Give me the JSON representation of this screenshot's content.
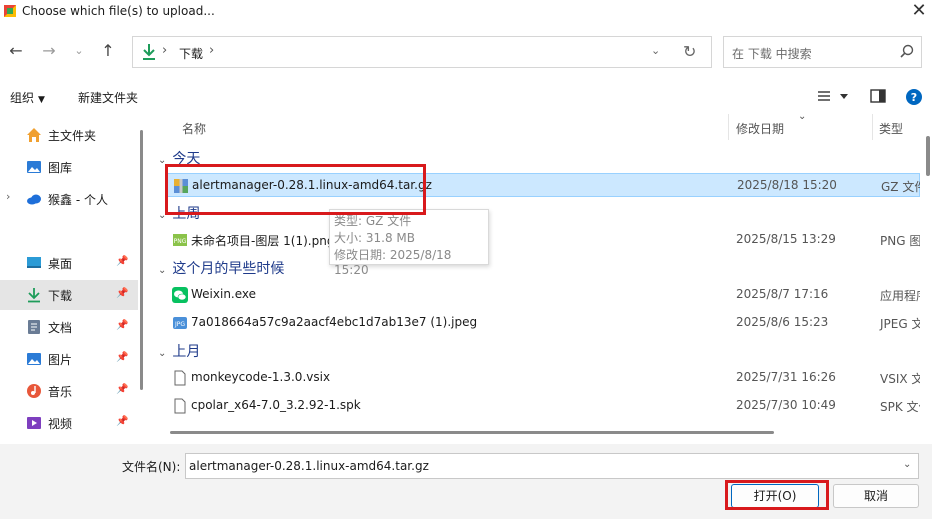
{
  "window": {
    "title": "Choose which file(s) to upload..."
  },
  "nav": {
    "path": "下载",
    "search_placeholder": "在 下载 中搜索"
  },
  "toolbar": {
    "organize": "组织",
    "new_folder": "新建文件夹"
  },
  "sidebar": {
    "items": [
      {
        "label": "主文件夹",
        "icon": "home-icon"
      },
      {
        "label": "图库",
        "icon": "gallery-icon"
      },
      {
        "label": "猴鑫 - 个人",
        "icon": "cloud-icon"
      },
      {
        "label": "桌面",
        "icon": "desktop-icon",
        "pinned": true
      },
      {
        "label": "下载",
        "icon": "download-icon",
        "pinned": true,
        "selected": true
      },
      {
        "label": "文档",
        "icon": "document-icon",
        "pinned": true
      },
      {
        "label": "图片",
        "icon": "picture-icon",
        "pinned": true
      },
      {
        "label": "音乐",
        "icon": "music-icon",
        "pinned": true
      },
      {
        "label": "视频",
        "icon": "video-icon",
        "pinned": true
      }
    ]
  },
  "columns": {
    "name": "名称",
    "date": "修改日期",
    "type": "类型"
  },
  "groups": [
    {
      "label": "今天",
      "files": [
        {
          "name": "alertmanager-0.28.1.linux-amd64.tar.gz",
          "date": "2025/8/18 15:20",
          "type": "GZ 文件",
          "icon": "archive-icon",
          "selected": true
        }
      ]
    },
    {
      "label": "上周",
      "files": [
        {
          "name": "未命名项目-图层 1(1).png",
          "date": "2025/8/15 13:29",
          "type": "PNG 图片",
          "icon": "png-icon"
        }
      ]
    },
    {
      "label": "这个月的早些时候",
      "files": [
        {
          "name": "Weixin.exe",
          "date": "2025/8/7 17:16",
          "type": "应用程序",
          "icon": "wechat-icon"
        },
        {
          "name": "7a018664a57c9a2aacf4ebc1d7ab13e7 (1).jpeg",
          "date": "2025/8/6 15:23",
          "type": "JPEG 文件",
          "icon": "jpeg-icon"
        }
      ]
    },
    {
      "label": "上月",
      "files": [
        {
          "name": "monkeycode-1.3.0.vsix",
          "date": "2025/7/31 16:26",
          "type": "VSIX 文件",
          "icon": "file-icon"
        },
        {
          "name": "cpolar_x64-7.0_3.2.92-1.spk",
          "date": "2025/7/30 10:49",
          "type": "SPK 文件",
          "icon": "file-icon"
        }
      ]
    }
  ],
  "tooltip": {
    "type": "类型: GZ 文件",
    "size": "大小: 31.8 MB",
    "modified": "修改日期: 2025/8/18 15:20"
  },
  "footer": {
    "filename_label": "文件名(N):",
    "filename_value": "alertmanager-0.28.1.linux-amd64.tar.gz",
    "open": "打开(O)",
    "cancel": "取消"
  },
  "colors": {
    "highlight": "#d8191c",
    "selection": "#cce8ff",
    "accent": "#0067c0"
  }
}
